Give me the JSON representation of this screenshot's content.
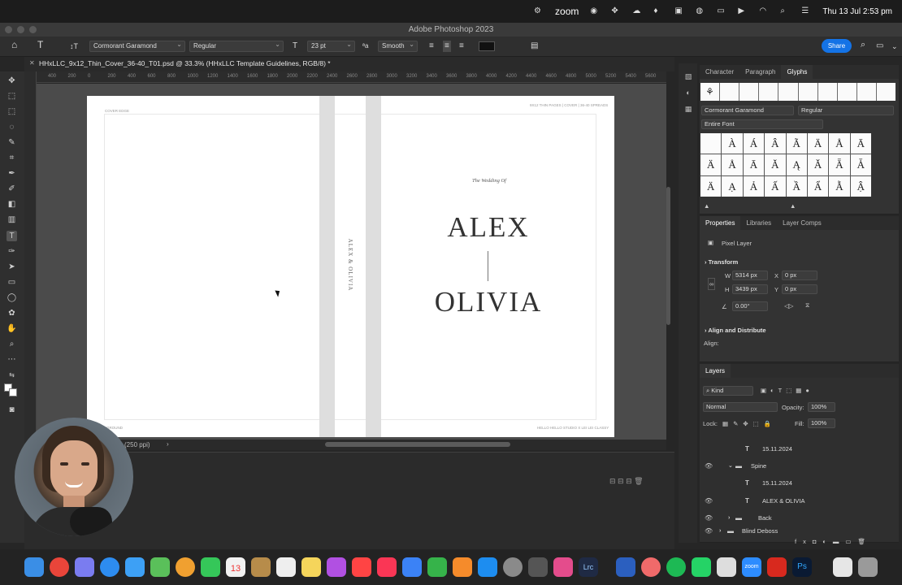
{
  "menubar": {
    "zoom_label": "zoom",
    "clock": "Thu 13 Jul  2:53 pm"
  },
  "window": {
    "title": "Adobe Photoshop 2023"
  },
  "options": {
    "font_family": "Cormorant Garamond",
    "font_style": "Regular",
    "font_size": "23 pt",
    "antialias": "Smooth",
    "share_label": "Share"
  },
  "document": {
    "tab_title": "HHxLLC_9x12_Thin_Cover_36-40_T01.psd @ 33.3% (HHxLLC Template Guidelines, RGB/8) *",
    "ruler_ticks": [
      "400",
      "200",
      "0",
      "200",
      "400",
      "600",
      "800",
      "1000",
      "1200",
      "1400",
      "1600",
      "1800",
      "2000",
      "2200",
      "2400",
      "2600",
      "2800",
      "3000",
      "3200",
      "3400",
      "3600",
      "3800",
      "4000",
      "4200",
      "4400",
      "4600",
      "4800",
      "5000",
      "5200",
      "5400",
      "5600"
    ],
    "cover_label": "COVER EDGE",
    "top_right_label": "9X12 THIN PAGES | COVER | 36-40 SPREADS",
    "bottom_left_label": "GROUND",
    "bottom_right_label": "HELLO HELLO STUDIO X LEI LEI CLASSY",
    "wedding_text": "The Wedding Of",
    "name1": "ALEX",
    "name2": "OLIVIA",
    "spine_text": "ALEX & OLIVIA",
    "status_text": "(250 ppi)"
  },
  "glyphs_panel": {
    "tabs": [
      "Character",
      "Paragraph",
      "Glyphs"
    ],
    "active_tab": "Glyphs",
    "font_family": "Cormorant Garamond",
    "font_style": "Regular",
    "subset": "Entire Font",
    "glyphs": [
      "",
      "À",
      "Á",
      "Â",
      "Ã",
      "Ä",
      "Å",
      "Ā",
      "Ä",
      "Å",
      "Ā",
      "Ă",
      "Ą",
      "Ǎ",
      "Ǟ",
      "Ǡ",
      "Ä",
      "Ạ",
      "Ả",
      "Ấ",
      "Ầ",
      "Ẩ",
      "Ẫ",
      "Ậ"
    ]
  },
  "properties_panel": {
    "tabs": [
      "Properties",
      "Libraries",
      "Layer Comps"
    ],
    "active_tab": "Properties",
    "layer_type": "Pixel Layer",
    "transform_label": "Transform",
    "w_label": "W",
    "w_value": "5314 px",
    "h_label": "H",
    "h_value": "3439 px",
    "x_label": "X",
    "x_value": "0 px",
    "y_label": "Y",
    "y_value": "0 px",
    "angle_value": "0.00°",
    "align_header": "Align and Distribute",
    "align_label": "Align:"
  },
  "layers_panel": {
    "title": "Layers",
    "kind_label": "Kind",
    "blend_mode": "Normal",
    "opacity_label": "Opacity:",
    "opacity_value": "100%",
    "lock_label": "Lock:",
    "fill_label": "Fill:",
    "fill_value": "100%",
    "rows": [
      {
        "name": "15.11.2024",
        "type": "T"
      },
      {
        "name": "Spine",
        "type": "folder"
      },
      {
        "name": "15.11.2024",
        "type": "T"
      },
      {
        "name": "ALEX & OLIVIA",
        "type": "T"
      },
      {
        "name": "Back",
        "type": "folder"
      },
      {
        "name": "Blind Deboss",
        "type": "folder"
      }
    ]
  }
}
